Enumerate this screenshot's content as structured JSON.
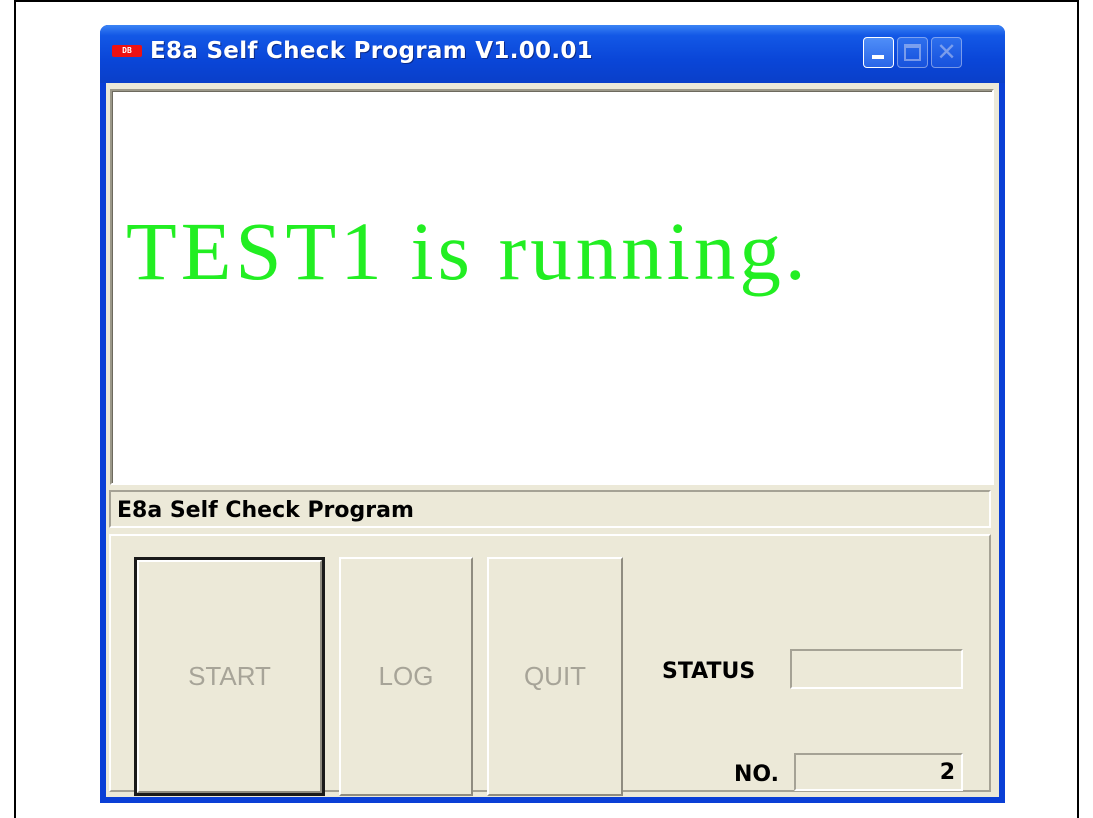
{
  "window": {
    "app_icon_text": "DB",
    "title": "E8a Self Check Program V1.00.01",
    "controls": {
      "minimize": "_",
      "maximize": "□",
      "close": "✕"
    }
  },
  "display": {
    "message": "TEST1 is running.",
    "message_color": "#22ee22"
  },
  "statusbar": {
    "text": "E8a Self Check Program"
  },
  "buttons": {
    "start_label": "START",
    "log_label": "LOG",
    "quit_label": "QUIT"
  },
  "fields": {
    "status_label": "STATUS",
    "status_value": "",
    "no_label": "NO.",
    "no_value": "2"
  }
}
